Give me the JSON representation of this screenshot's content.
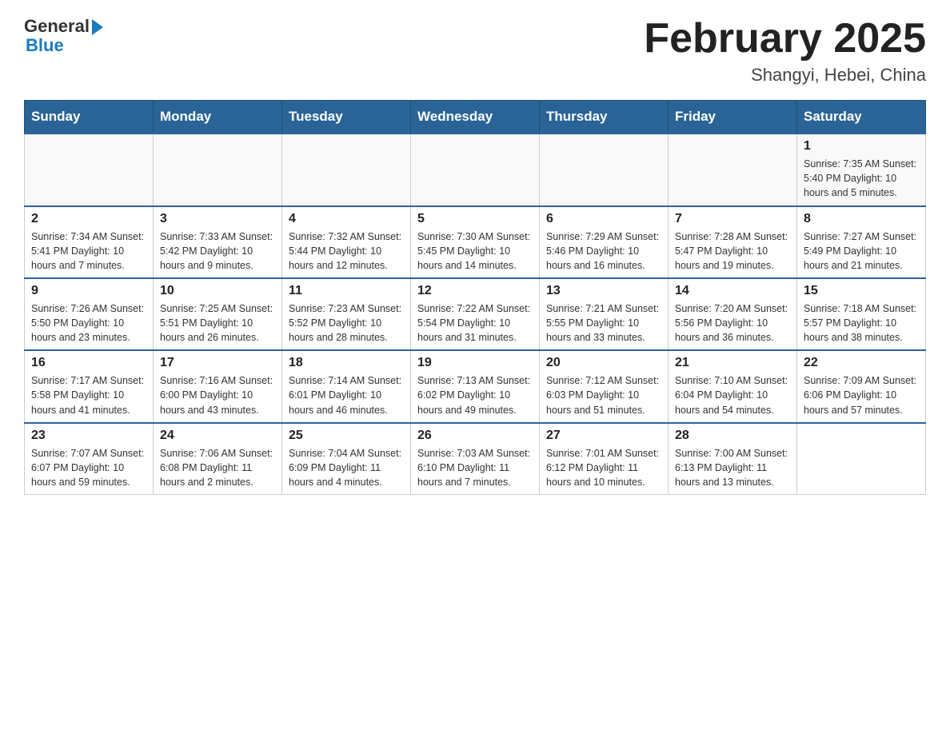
{
  "header": {
    "logo_general": "General",
    "logo_blue": "Blue",
    "title": "February 2025",
    "subtitle": "Shangyi, Hebei, China"
  },
  "days_of_week": [
    "Sunday",
    "Monday",
    "Tuesday",
    "Wednesday",
    "Thursday",
    "Friday",
    "Saturday"
  ],
  "weeks": [
    [
      {
        "day": "",
        "info": ""
      },
      {
        "day": "",
        "info": ""
      },
      {
        "day": "",
        "info": ""
      },
      {
        "day": "",
        "info": ""
      },
      {
        "day": "",
        "info": ""
      },
      {
        "day": "",
        "info": ""
      },
      {
        "day": "1",
        "info": "Sunrise: 7:35 AM\nSunset: 5:40 PM\nDaylight: 10 hours and 5 minutes."
      }
    ],
    [
      {
        "day": "2",
        "info": "Sunrise: 7:34 AM\nSunset: 5:41 PM\nDaylight: 10 hours and 7 minutes."
      },
      {
        "day": "3",
        "info": "Sunrise: 7:33 AM\nSunset: 5:42 PM\nDaylight: 10 hours and 9 minutes."
      },
      {
        "day": "4",
        "info": "Sunrise: 7:32 AM\nSunset: 5:44 PM\nDaylight: 10 hours and 12 minutes."
      },
      {
        "day": "5",
        "info": "Sunrise: 7:30 AM\nSunset: 5:45 PM\nDaylight: 10 hours and 14 minutes."
      },
      {
        "day": "6",
        "info": "Sunrise: 7:29 AM\nSunset: 5:46 PM\nDaylight: 10 hours and 16 minutes."
      },
      {
        "day": "7",
        "info": "Sunrise: 7:28 AM\nSunset: 5:47 PM\nDaylight: 10 hours and 19 minutes."
      },
      {
        "day": "8",
        "info": "Sunrise: 7:27 AM\nSunset: 5:49 PM\nDaylight: 10 hours and 21 minutes."
      }
    ],
    [
      {
        "day": "9",
        "info": "Sunrise: 7:26 AM\nSunset: 5:50 PM\nDaylight: 10 hours and 23 minutes."
      },
      {
        "day": "10",
        "info": "Sunrise: 7:25 AM\nSunset: 5:51 PM\nDaylight: 10 hours and 26 minutes."
      },
      {
        "day": "11",
        "info": "Sunrise: 7:23 AM\nSunset: 5:52 PM\nDaylight: 10 hours and 28 minutes."
      },
      {
        "day": "12",
        "info": "Sunrise: 7:22 AM\nSunset: 5:54 PM\nDaylight: 10 hours and 31 minutes."
      },
      {
        "day": "13",
        "info": "Sunrise: 7:21 AM\nSunset: 5:55 PM\nDaylight: 10 hours and 33 minutes."
      },
      {
        "day": "14",
        "info": "Sunrise: 7:20 AM\nSunset: 5:56 PM\nDaylight: 10 hours and 36 minutes."
      },
      {
        "day": "15",
        "info": "Sunrise: 7:18 AM\nSunset: 5:57 PM\nDaylight: 10 hours and 38 minutes."
      }
    ],
    [
      {
        "day": "16",
        "info": "Sunrise: 7:17 AM\nSunset: 5:58 PM\nDaylight: 10 hours and 41 minutes."
      },
      {
        "day": "17",
        "info": "Sunrise: 7:16 AM\nSunset: 6:00 PM\nDaylight: 10 hours and 43 minutes."
      },
      {
        "day": "18",
        "info": "Sunrise: 7:14 AM\nSunset: 6:01 PM\nDaylight: 10 hours and 46 minutes."
      },
      {
        "day": "19",
        "info": "Sunrise: 7:13 AM\nSunset: 6:02 PM\nDaylight: 10 hours and 49 minutes."
      },
      {
        "day": "20",
        "info": "Sunrise: 7:12 AM\nSunset: 6:03 PM\nDaylight: 10 hours and 51 minutes."
      },
      {
        "day": "21",
        "info": "Sunrise: 7:10 AM\nSunset: 6:04 PM\nDaylight: 10 hours and 54 minutes."
      },
      {
        "day": "22",
        "info": "Sunrise: 7:09 AM\nSunset: 6:06 PM\nDaylight: 10 hours and 57 minutes."
      }
    ],
    [
      {
        "day": "23",
        "info": "Sunrise: 7:07 AM\nSunset: 6:07 PM\nDaylight: 10 hours and 59 minutes."
      },
      {
        "day": "24",
        "info": "Sunrise: 7:06 AM\nSunset: 6:08 PM\nDaylight: 11 hours and 2 minutes."
      },
      {
        "day": "25",
        "info": "Sunrise: 7:04 AM\nSunset: 6:09 PM\nDaylight: 11 hours and 4 minutes."
      },
      {
        "day": "26",
        "info": "Sunrise: 7:03 AM\nSunset: 6:10 PM\nDaylight: 11 hours and 7 minutes."
      },
      {
        "day": "27",
        "info": "Sunrise: 7:01 AM\nSunset: 6:12 PM\nDaylight: 11 hours and 10 minutes."
      },
      {
        "day": "28",
        "info": "Sunrise: 7:00 AM\nSunset: 6:13 PM\nDaylight: 11 hours and 13 minutes."
      },
      {
        "day": "",
        "info": ""
      }
    ]
  ]
}
